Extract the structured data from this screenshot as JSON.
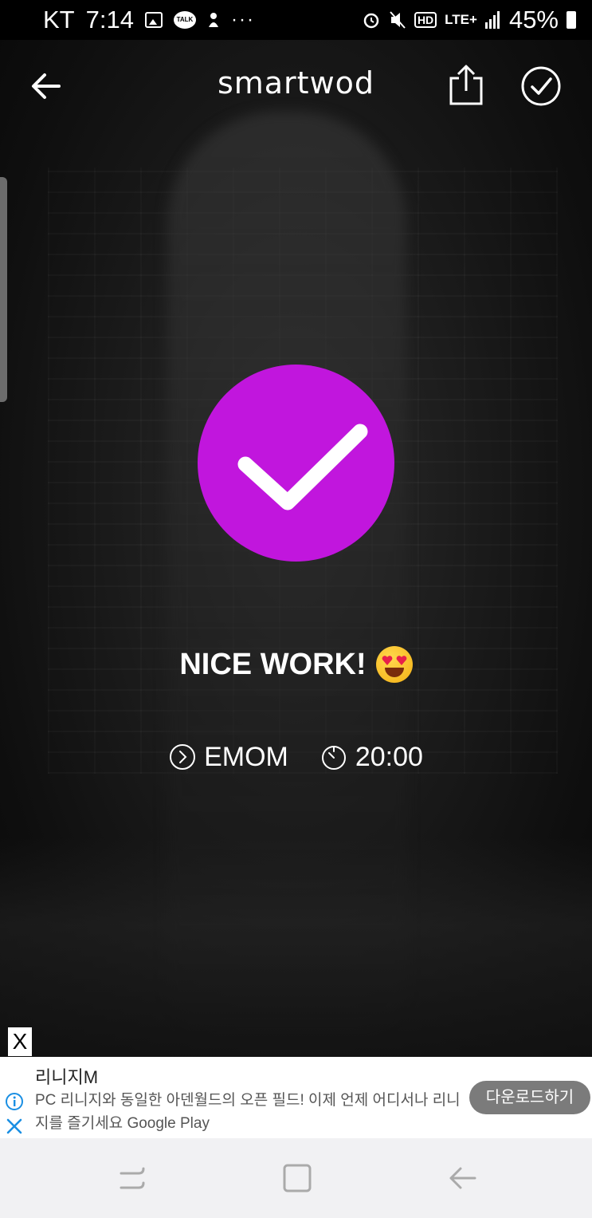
{
  "status_bar": {
    "carrier": "KT",
    "time": "7:14",
    "notification_icons": [
      "gallery-icon",
      "kakaotalk-icon",
      "app-icon"
    ],
    "more": "···",
    "hd_badge": "HD",
    "network": "LTE+",
    "battery": "45%"
  },
  "header": {
    "app_title": "smartwod"
  },
  "result": {
    "headline": "NICE WORK!",
    "workout_type": "EMOM",
    "duration": "20:00"
  },
  "ad": {
    "close_label": "X",
    "title": "리니지M",
    "text": "PC 리니지와 동일한 아덴월드의 오픈 필드! 이제 언제 어디서나 리니지를 즐기세요 Google Play",
    "cta": "다운로드하기"
  },
  "colors": {
    "accent": "#c116dd",
    "ad_cta": "#7b7b7b",
    "nav_bg": "#f1f1f3"
  }
}
